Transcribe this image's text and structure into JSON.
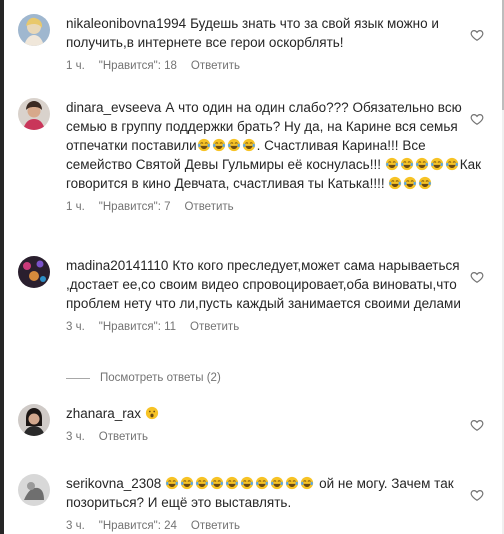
{
  "comments": [
    {
      "username": "nikaleonibovna1994",
      "text": "Будешь знать что за свой язык можно и получить,в интернете все герои оскорблять!",
      "time": "1 ч.",
      "likes": "\"Нравится\": 18",
      "reply": "Ответить"
    },
    {
      "username": "dinara_evseeva",
      "text_a": "А что один на один слабо??? Обязательно всю семью в группу поддержки брать? Ну да, на Карине вся семья отпечатки поставили",
      "text_b": ". Счастливая Карина!!! Все семейство Святой Девы Гульмиры её коснулась!!!",
      "text_c": "Как говорится в кино Девчата, счастливая ты Катька!!!!",
      "time": "1 ч.",
      "likes": "\"Нравится\": 7",
      "reply": "Ответить"
    },
    {
      "username": "madina20141110",
      "text": "Кто кого преследует,может сама нарываеться ,достает ее,со своим видео спровоцировает,оба виноваты,что проблем нету что ли,пусть каждый занимается своими делами",
      "time": "3 ч.",
      "likes": "\"Нравится\": 11",
      "reply": "Ответить"
    },
    {
      "username": "zhanara_rax",
      "text": "",
      "time": "3 ч.",
      "reply": "Ответить"
    },
    {
      "username": "serikovna_2308",
      "text_b": "ой не могу. Зачем так позориться? И ещё это выставлять.",
      "time": "3 ч.",
      "likes": "\"Нравится\": 24",
      "reply": "Ответить"
    }
  ],
  "view_replies": "Посмотреть ответы (2)",
  "icons": {
    "like": "heart-outline-icon",
    "laugh": "face-with-tears-of-joy-emoji",
    "surprised": "face-with-open-mouth-emoji"
  },
  "colors": {
    "text": "#262626",
    "secondary": "#737373",
    "emoji": "#f7c325"
  }
}
